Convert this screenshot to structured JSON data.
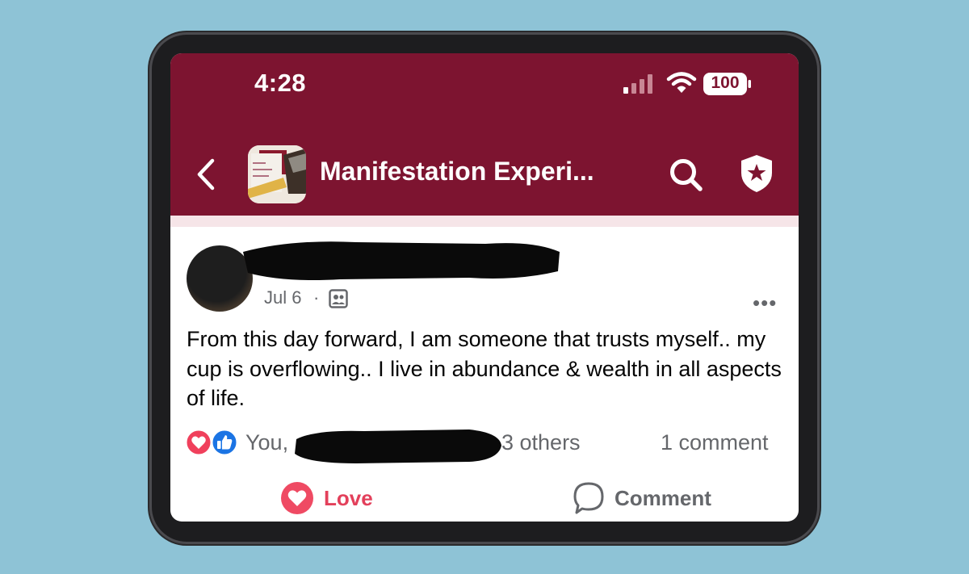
{
  "status_bar": {
    "time": "4:28",
    "battery": "100"
  },
  "header": {
    "group_title": "Manifestation Experi..."
  },
  "post": {
    "date": "Jul 6",
    "separator": "·",
    "text": "From this day forward, I am someone that trusts myself.. my cup is overflowing.. I live in abundance & wealth in all aspects of life.",
    "more_label": "•••"
  },
  "reactions": {
    "reactors_prefix": "You,",
    "others": "3 others",
    "comment_count": "1 comment"
  },
  "actions": {
    "love_label": "Love",
    "comment_label": "Comment"
  },
  "colors": {
    "header_bg": "#7d1430",
    "love": "#e3405b",
    "like": "#1b74e4",
    "muted_text": "#65676b"
  },
  "icons": [
    "back-chevron-icon",
    "search-icon",
    "shield-star-icon",
    "audience-group-icon",
    "more-icon",
    "love-reaction-icon",
    "like-reaction-icon",
    "comment-bubble-icon",
    "signal-icon",
    "wifi-icon",
    "battery-icon"
  ]
}
